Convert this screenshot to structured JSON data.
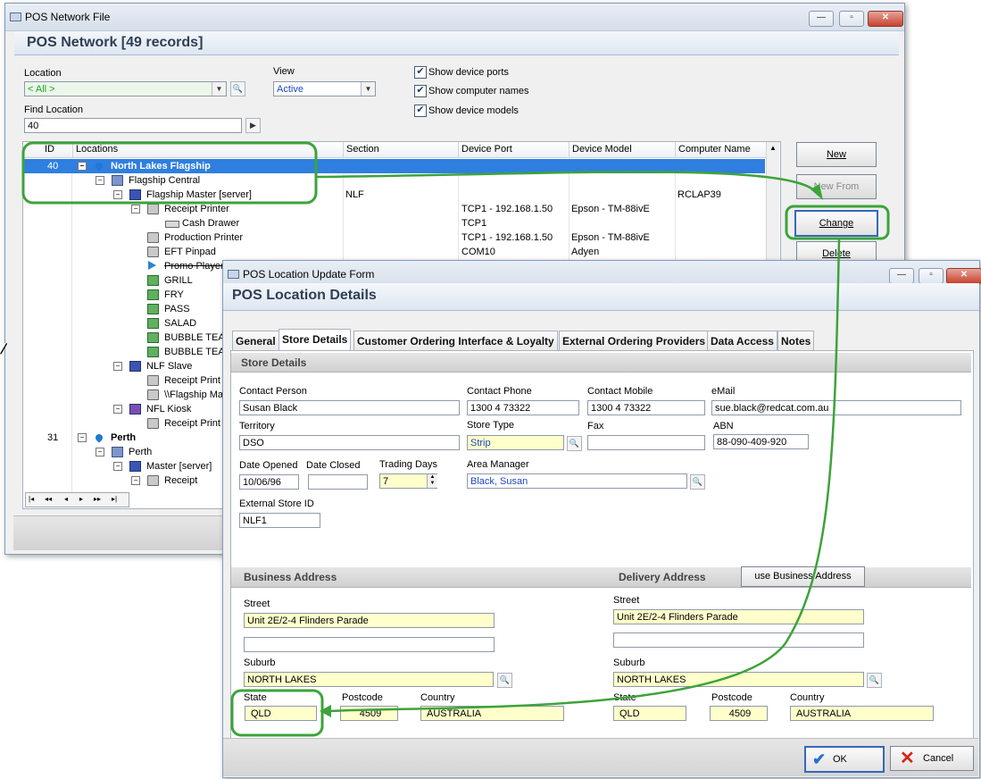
{
  "network_window": {
    "title": "POS Network File",
    "header": "POS Network [49 records]",
    "location_label": "Location",
    "location_value": "< All >",
    "view_label": "View",
    "view_value": "Active",
    "find_label": "Find Location",
    "find_value": "40",
    "checkboxes": [
      "Show device ports",
      "Show computer names",
      "Show device models"
    ],
    "columns": [
      "ID",
      "Locations",
      "Section",
      "Device Port",
      "Device Model",
      "Computer Name"
    ],
    "buttons": {
      "new": "New",
      "new_from": "New From",
      "change": "Change",
      "delete": "Delete"
    },
    "rows": [
      {
        "id": "40",
        "name": "North Lakes Flagship",
        "section": "",
        "port": "",
        "model": "",
        "computer": ""
      },
      {
        "id": "",
        "name": "Flagship Central",
        "section": "",
        "port": "",
        "model": "",
        "computer": ""
      },
      {
        "id": "",
        "name": "Flagship Master [server]",
        "section": "NLF",
        "port": "",
        "model": "",
        "computer": "RCLAP39"
      },
      {
        "id": "",
        "name": "Receipt Printer",
        "section": "",
        "port": "TCP1 - 192.168.1.50",
        "model": "Epson - TM-88ivE",
        "computer": ""
      },
      {
        "id": "",
        "name": "Cash Drawer",
        "section": "",
        "port": "TCP1",
        "model": "",
        "computer": ""
      },
      {
        "id": "",
        "name": "Production Printer",
        "section": "",
        "port": "TCP1 - 192.168.1.50",
        "model": "Epson - TM-88ivE",
        "computer": ""
      },
      {
        "id": "",
        "name": "EFT Pinpad",
        "section": "",
        "port": "COM10",
        "model": "Adyen",
        "computer": ""
      },
      {
        "id": "",
        "name": "Promo Player",
        "section": "",
        "port": "",
        "model": "",
        "computer": ""
      },
      {
        "id": "",
        "name": "GRILL",
        "section": "",
        "port": "",
        "model": "",
        "computer": ""
      },
      {
        "id": "",
        "name": "FRY",
        "section": "",
        "port": "",
        "model": "",
        "computer": ""
      },
      {
        "id": "",
        "name": "PASS",
        "section": "",
        "port": "",
        "model": "",
        "computer": ""
      },
      {
        "id": "",
        "name": "SALAD",
        "section": "",
        "port": "",
        "model": "",
        "computer": ""
      },
      {
        "id": "",
        "name": "BUBBLE TEA",
        "section": "",
        "port": "",
        "model": "",
        "computer": ""
      },
      {
        "id": "",
        "name": "BUBBLE TEA",
        "section": "",
        "port": "",
        "model": "",
        "computer": ""
      },
      {
        "id": "",
        "name": "NLF Slave",
        "section": "",
        "port": "",
        "model": "",
        "computer": ""
      },
      {
        "id": "",
        "name": "Receipt Print",
        "section": "",
        "port": "",
        "model": "",
        "computer": ""
      },
      {
        "id": "",
        "name": "\\\\Flagship Ma",
        "section": "",
        "port": "",
        "model": "",
        "computer": ""
      },
      {
        "id": "",
        "name": "NFL Kiosk",
        "section": "",
        "port": "",
        "model": "",
        "computer": ""
      },
      {
        "id": "",
        "name": "Receipt Print",
        "section": "",
        "port": "",
        "model": "",
        "computer": ""
      },
      {
        "id": "31",
        "name": "Perth",
        "section": "",
        "port": "",
        "model": "",
        "computer": ""
      },
      {
        "id": "",
        "name": "Perth",
        "section": "",
        "port": "",
        "model": "",
        "computer": ""
      },
      {
        "id": "",
        "name": "Master [server]",
        "section": "",
        "port": "",
        "model": "",
        "computer": ""
      },
      {
        "id": "",
        "name": "Receipt",
        "section": "",
        "port": "",
        "model": "",
        "computer": ""
      }
    ],
    "nav": [
      "|◂",
      "◂◂",
      "◂",
      "▸",
      "▸▸",
      "▸|"
    ]
  },
  "update_window": {
    "title": "POS Location Update Form",
    "header": "POS Location Details",
    "tabs": [
      "General",
      "Store Details",
      "Customer Ordering Interface & Loyalty",
      "External Ordering Providers",
      "Data Access",
      "Notes"
    ],
    "section_store": "Store Details",
    "contact_person_label": "Contact Person",
    "contact_person": "Susan Black",
    "contact_phone_label": "Contact Phone",
    "contact_phone": "1300 4 73322",
    "contact_mobile_label": "Contact Mobile",
    "contact_mobile": "1300 4 73322",
    "email_label": "eMail",
    "email": "sue.black@redcat.com.au",
    "territory_label": "Territory",
    "territory": "DSO",
    "store_type_label": "Store Type",
    "store_type": "Strip",
    "fax_label": "Fax",
    "fax": "",
    "abn_label": "ABN",
    "abn": "88-090-409-920",
    "date_opened_label": "Date Opened",
    "date_opened": "10/06/96",
    "date_closed_label": "Date Closed",
    "date_closed": "",
    "trading_days_label": "Trading Days",
    "trading_days": "7",
    "area_manager_label": "Area Manager",
    "area_manager": "Black, Susan",
    "external_store_id_label": "External Store ID",
    "external_store_id": "NLF1",
    "business_address": "Business Address",
    "delivery_address": "Delivery Address",
    "use_business_address": "use Business Address",
    "street_label": "Street",
    "business_street": "Unit 2E/2-4 Flinders Parade",
    "delivery_street": "Unit 2E/2-4 Flinders Parade",
    "suburb_label": "Suburb",
    "business_suburb": "NORTH LAKES",
    "delivery_suburb": "NORTH LAKES",
    "state_label": "State",
    "postcode_label": "Postcode",
    "country_label": "Country",
    "business_state": "QLD",
    "business_postcode": "4509",
    "business_country": "AUSTRALIA",
    "delivery_state": "QLD",
    "delivery_postcode": "4509",
    "delivery_country": "AUSTRALIA",
    "ok": "OK",
    "cancel": "Cancel"
  },
  "colors": {
    "selection": "#2f7fe0",
    "highlight": "#3da33a",
    "required": "#ffffcc"
  }
}
